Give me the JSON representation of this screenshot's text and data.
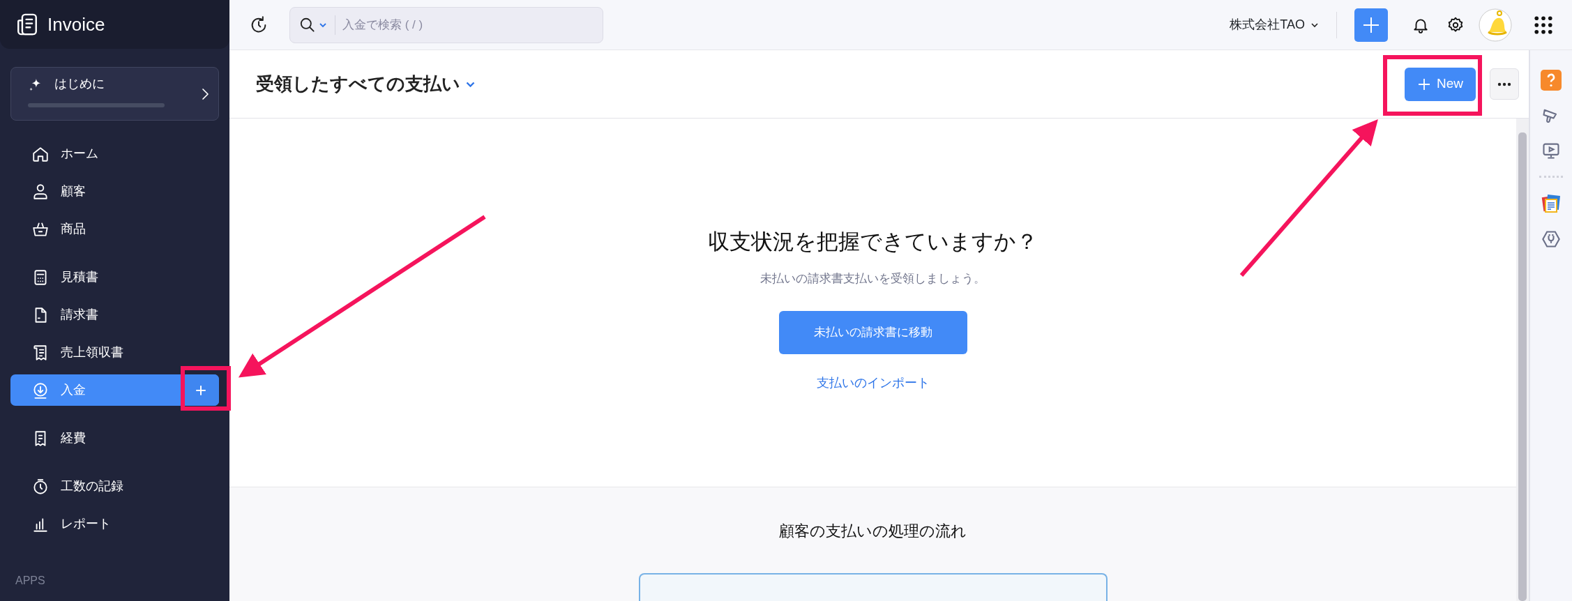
{
  "app": {
    "title": "Invoice"
  },
  "getting_started": {
    "label": "はじめに",
    "level": 0
  },
  "sidebar": {
    "groups": [
      {
        "items": [
          {
            "label": "ホーム",
            "selected": false
          },
          {
            "label": "顧客",
            "selected": false
          },
          {
            "label": "商品",
            "selected": false
          }
        ]
      },
      {
        "items": [
          {
            "label": "見積書",
            "selected": false
          },
          {
            "label": "請求書",
            "selected": false
          },
          {
            "label": "売上領収書",
            "selected": false
          },
          {
            "label": "入金",
            "selected": true
          }
        ]
      },
      {
        "items": [
          {
            "label": "経費",
            "selected": false
          }
        ]
      },
      {
        "items": [
          {
            "label": "工数の記録",
            "selected": false
          },
          {
            "label": "レポート",
            "selected": false
          }
        ]
      }
    ],
    "apps_label": "APPS"
  },
  "topbar": {
    "search": {
      "placeholder": "入金で検索 ( / )"
    },
    "organization": "株式会社TAO"
  },
  "page_header": {
    "title": "受領したすべての支払い",
    "new_button": "New"
  },
  "empty_state": {
    "title": "収支状況を把握できていますか？",
    "subtitle": "未払いの請求書支払いを受領しましょう。",
    "button": "未払いの請求書に移動",
    "link": "支払いのインポート"
  },
  "flow_section": {
    "title": "顧客の支払いの処理の流れ"
  }
}
